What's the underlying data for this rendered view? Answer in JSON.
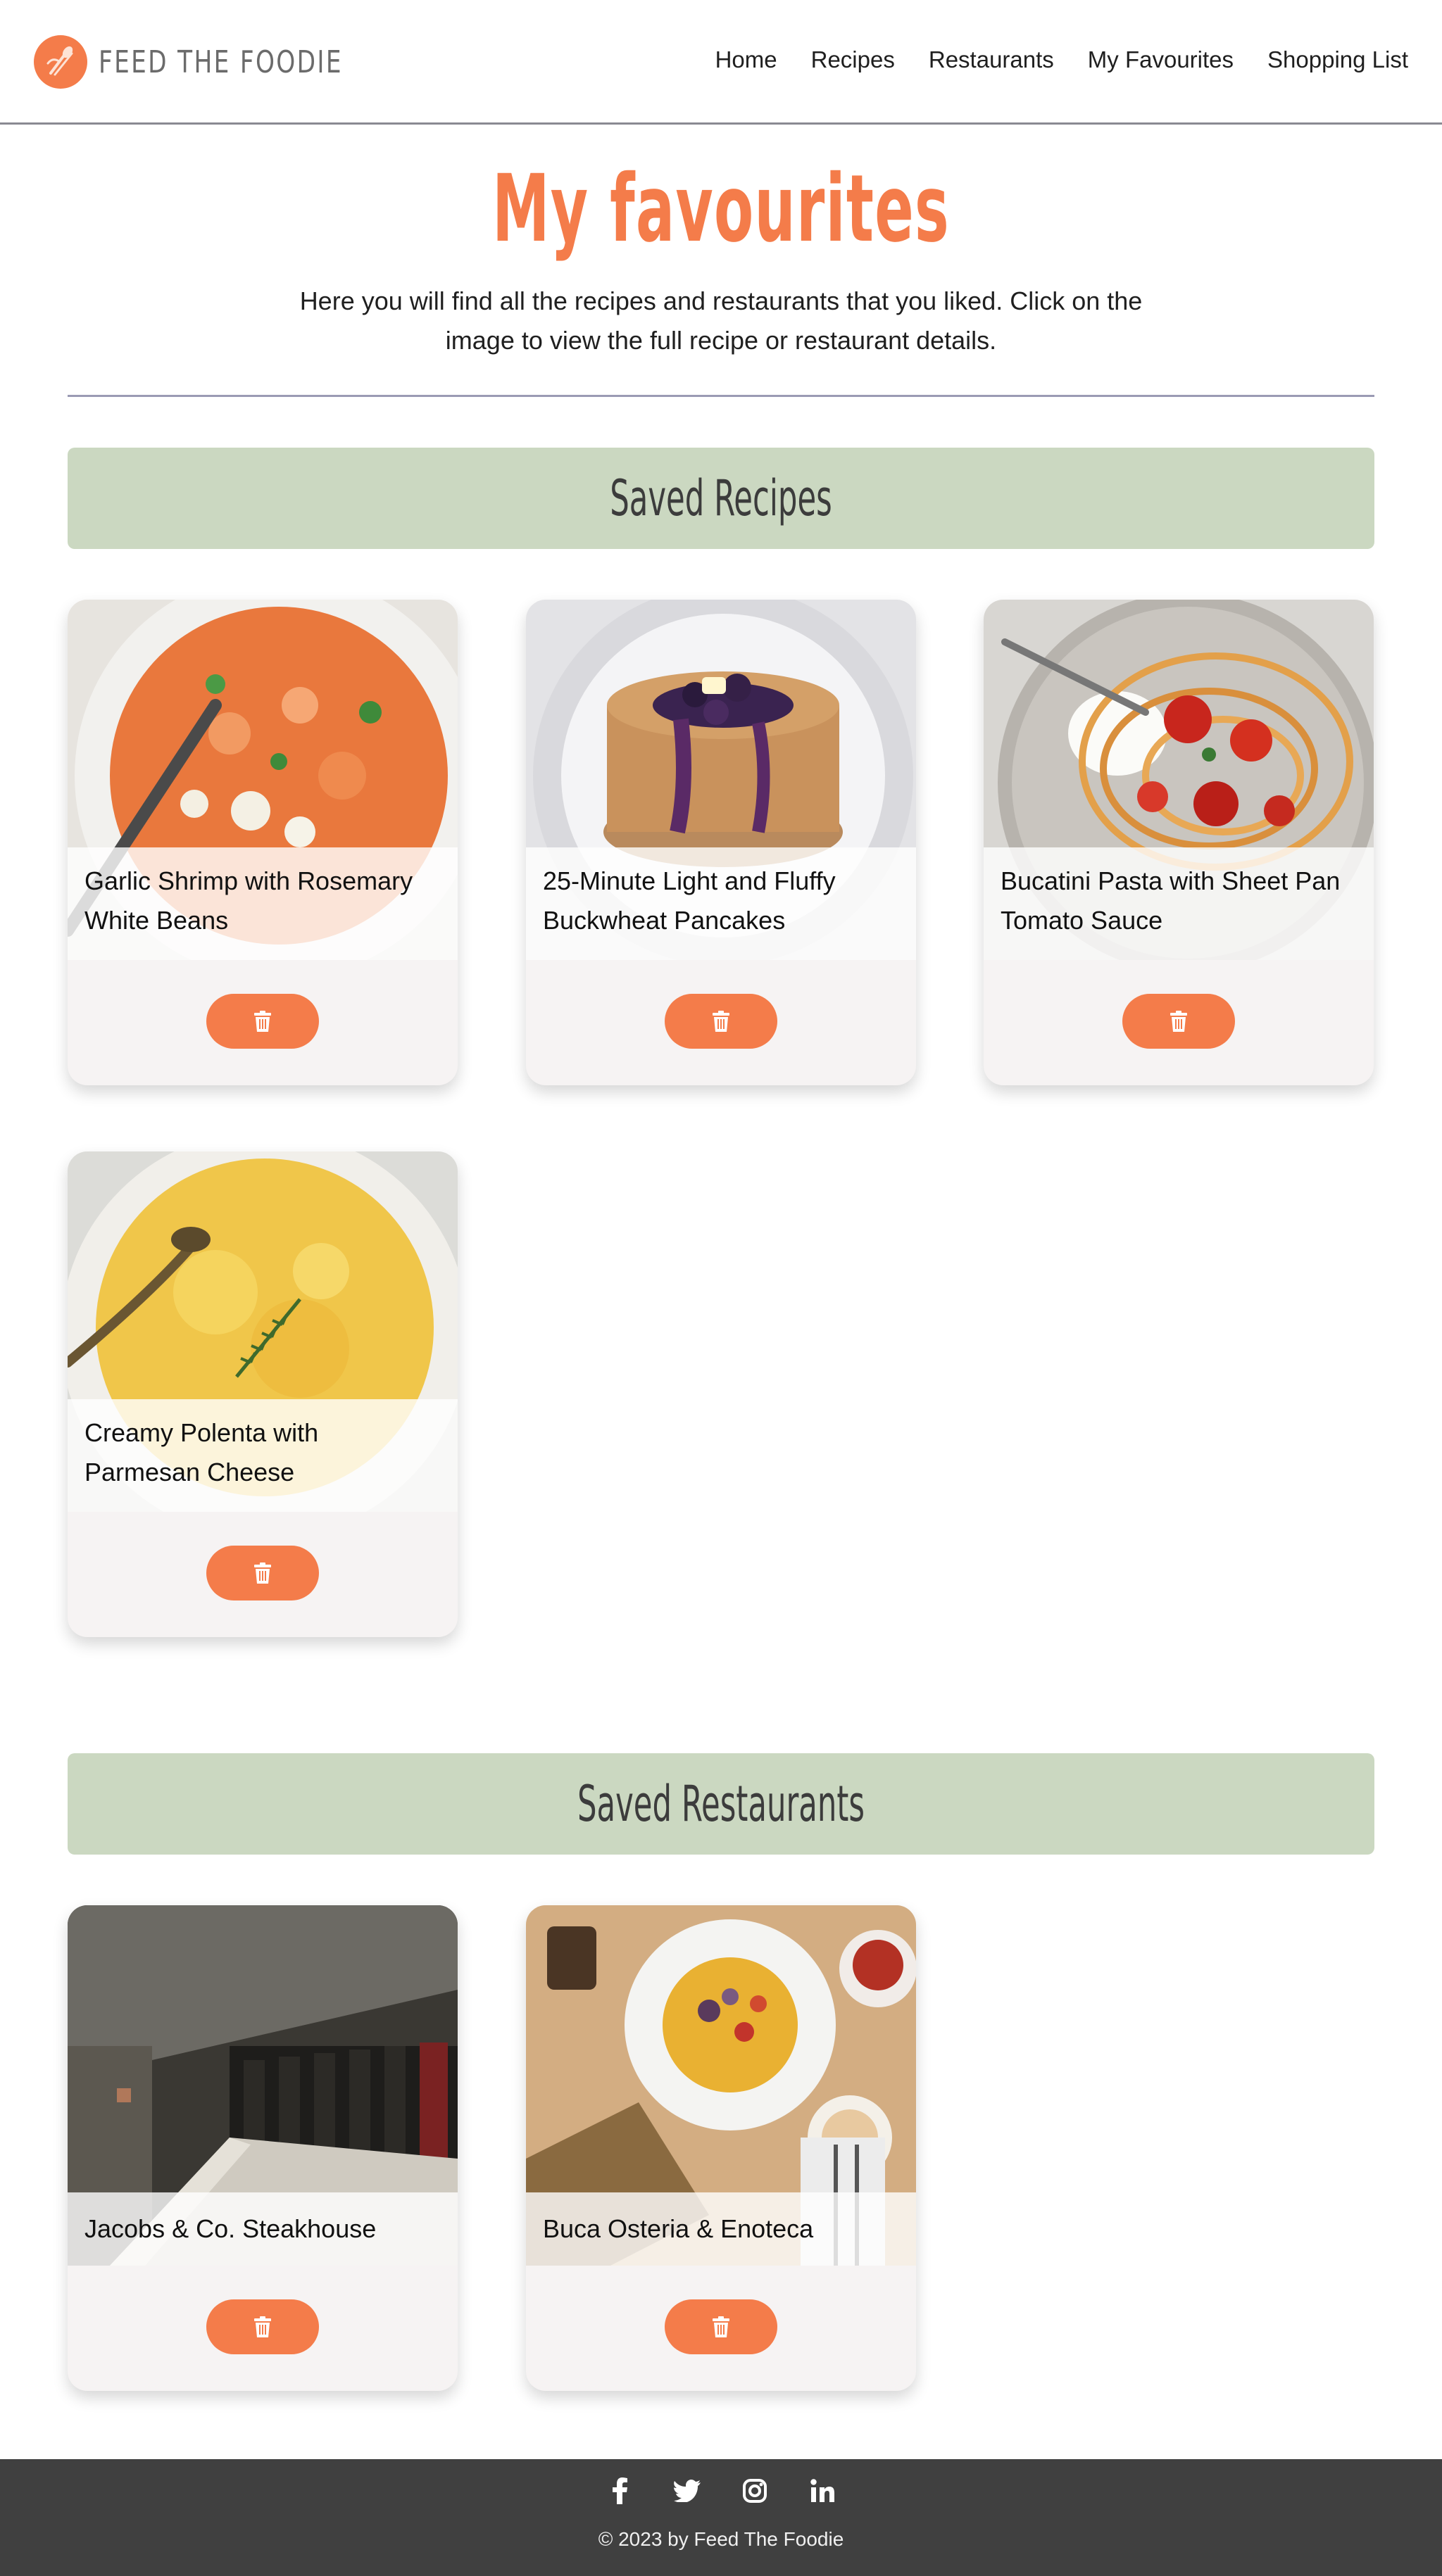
{
  "brand": {
    "name": "FEED THE FOODIE",
    "accent": "#f47c4a"
  },
  "nav": {
    "items": [
      {
        "label": "Home"
      },
      {
        "label": "Recipes"
      },
      {
        "label": "Restaurants"
      },
      {
        "label": "My Favourites"
      },
      {
        "label": "Shopping List"
      }
    ]
  },
  "intro": {
    "title": "My favourites",
    "text": "Here you will find all the recipes and restaurants that you liked. Click on the image to view the full recipe or restaurant details."
  },
  "sections": {
    "recipes_title": "Saved Recipes",
    "restaurants_title": "Saved Restaurants",
    "banner_color": "#cbd8c1"
  },
  "recipes": [
    {
      "name": "Garlic Shrimp with Rosemary White Beans",
      "image": "shrimp-beans"
    },
    {
      "name": "25-Minute Light and Fluffy Buckwheat Pancakes",
      "image": "blueberry-pancakes"
    },
    {
      "name": "Bucatini Pasta with Sheet Pan Tomato Sauce",
      "image": "tomato-pasta"
    },
    {
      "name": "Creamy Polenta with Parmesan Cheese",
      "image": "polenta"
    }
  ],
  "restaurants": [
    {
      "name": "Jacobs & Co. Steakhouse",
      "image": "steakhouse-bar"
    },
    {
      "name": "Buca Osteria & Enoteca",
      "image": "osteria-table"
    }
  ],
  "card": {
    "delete_icon": "trash-icon"
  },
  "footer": {
    "social": [
      "facebook-icon",
      "twitter-icon",
      "instagram-icon",
      "linkedin-icon"
    ],
    "copyright": "© 2023 by Feed The Foodie"
  }
}
